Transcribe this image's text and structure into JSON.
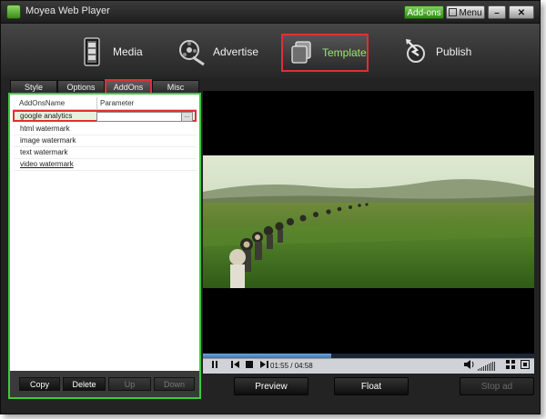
{
  "titlebar": {
    "title": "Moyea Web Player",
    "addons_label": "Add-ons",
    "menu_label": "Menu",
    "minimize_label": "–",
    "close_label": "✕"
  },
  "nav": {
    "items": [
      {
        "label": "Media",
        "icon": "film-icon"
      },
      {
        "label": "Advertise",
        "icon": "film-reel-icon"
      },
      {
        "label": "Template",
        "icon": "template-stack-icon",
        "selected": true
      },
      {
        "label": "Publish",
        "icon": "publish-icon"
      }
    ]
  },
  "subtabs": {
    "style": "Style",
    "options": "Options",
    "addons": "AddOns",
    "misc": "Misc",
    "active": "AddOns"
  },
  "addons_list": {
    "col_name": "AddOnsName",
    "col_param": "Parameter",
    "rows": [
      {
        "name": "google analytics",
        "selected": true
      },
      {
        "name": "html watermark"
      },
      {
        "name": "image watermark"
      },
      {
        "name": "text watermark"
      },
      {
        "name": "video watermark"
      }
    ],
    "param_value": "",
    "param_button": "..."
  },
  "left_buttons": {
    "copy": "Copy",
    "delete": "Delete",
    "up": "Up",
    "down": "Down"
  },
  "player": {
    "current_time": "01:55",
    "duration": "04:58",
    "time_display": "01:55 / 04:58",
    "progress": 0.386
  },
  "bottom_buttons": {
    "preview": "Preview",
    "float": "Float",
    "stop_ad": "Stop ad"
  },
  "colors": {
    "accent_green": "#3bcc3b",
    "highlight_red": "#e03030",
    "selected_text": "#9be86e"
  }
}
